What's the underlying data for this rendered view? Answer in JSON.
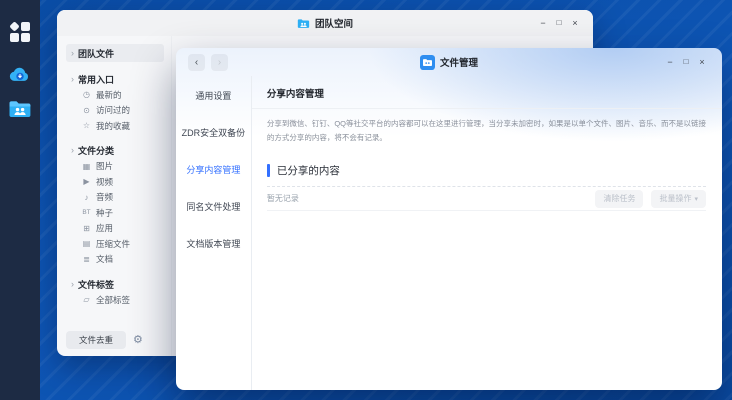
{
  "colors": {
    "accent": "#3370ff",
    "desktop_blue": "#0d52ac",
    "dock_bg": "#1d2b44",
    "icon_blue": "#2eb0f5"
  },
  "icons": {
    "chevron": "›",
    "up_arrow": "↑",
    "clock": "◷",
    "history": "⊙",
    "star": "☆",
    "image": "▦",
    "video": "▶",
    "audio": "♪",
    "torrent": "BT",
    "apps": "⊞",
    "archive": "▤",
    "document": "≣",
    "tag": "▱",
    "gear": "⚙",
    "caret_down": "▾",
    "nav_back": "‹",
    "nav_forward": "›",
    "minimize": "−",
    "maximize": "□",
    "close": "×"
  },
  "back_window": {
    "title": "团队空间",
    "toolbar": {
      "breadcrumb": "团队文件"
    },
    "sidebar": {
      "root_item": "团队文件",
      "groups": [
        {
          "label": "常用入口",
          "items": [
            {
              "label": "最新的"
            },
            {
              "label": "访问过的"
            },
            {
              "label": "我的收藏"
            }
          ]
        },
        {
          "label": "文件分类",
          "items": [
            {
              "label": "图片"
            },
            {
              "label": "视频"
            },
            {
              "label": "音频"
            },
            {
              "label": "种子"
            },
            {
              "label": "应用"
            },
            {
              "label": "压缩文件"
            },
            {
              "label": "文档"
            }
          ]
        },
        {
          "label": "文件标签",
          "items": [
            {
              "label": "全部标签"
            }
          ]
        }
      ],
      "dedupe_button": "文件去重"
    }
  },
  "front_window": {
    "title": "文件管理",
    "tabs": [
      "通用设置",
      "ZDR安全双备份",
      "分享内容管理",
      "同名文件处理",
      "文档版本管理"
    ],
    "content": {
      "header": "分享内容管理",
      "description_lines": [
        "分享到微信、钉钉、QQ等社交平台的内容都可以在这里进行管理，当分享未加密时，如果是以单个文件、图片、音乐、而不是以链接",
        "的方式分享的内容，将不会有记录。"
      ],
      "section_title": "已分享的内容",
      "empty_text": "暂无记录",
      "clear_button": "清除任务",
      "batch_button": "批量操作"
    }
  }
}
